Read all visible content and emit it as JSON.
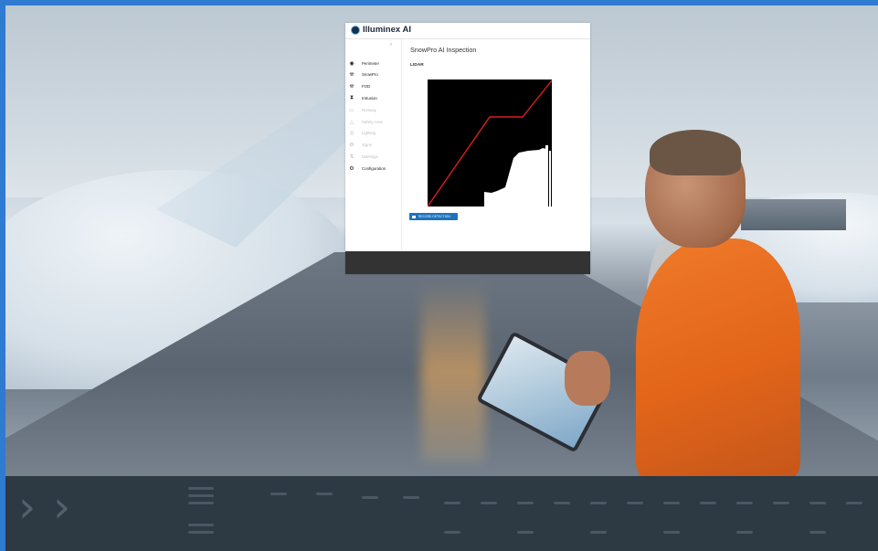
{
  "app": {
    "brand": "Illuminex AI",
    "collapse_icon": "chevron-left-icon",
    "page_title": "SnowPro AI Inspection",
    "section_label": "LIDAR",
    "record_button_label": "RECORD DETECTION",
    "record_icon": "flag-icon"
  },
  "sidebar": {
    "items": [
      {
        "label": "Perimeter",
        "icon": "perimeter-icon",
        "glyph": "◉",
        "enabled": true
      },
      {
        "label": "SnowPro",
        "icon": "snowpro-icon",
        "glyph": "⛯",
        "enabled": true
      },
      {
        "label": "FOD",
        "icon": "fod-icon",
        "glyph": "⛯",
        "enabled": true
      },
      {
        "label": "Intrusion",
        "icon": "intrusion-icon",
        "glyph": "⧗",
        "enabled": true
      },
      {
        "label": "Runway",
        "icon": "runway-icon",
        "glyph": "▭",
        "enabled": false
      },
      {
        "label": "Safety Area",
        "icon": "safety-area-icon",
        "glyph": "△",
        "enabled": false
      },
      {
        "label": "Lighting",
        "icon": "lighting-icon",
        "glyph": "◎",
        "enabled": false
      },
      {
        "label": "Signs",
        "icon": "signs-icon",
        "glyph": "⚙",
        "enabled": false
      },
      {
        "label": "Markings",
        "icon": "markings-icon",
        "glyph": "⇅",
        "enabled": false
      },
      {
        "label": "Configuration",
        "icon": "gear-icon",
        "glyph": "⚙",
        "enabled": true
      }
    ]
  },
  "lidar_plot": {
    "background": "#000000",
    "line_color": "#d81e1e",
    "surface_color": "#ffffff"
  },
  "colors": {
    "accent": "#1e73be",
    "frame_border": "#2f7bd1",
    "footer": "#333333"
  }
}
